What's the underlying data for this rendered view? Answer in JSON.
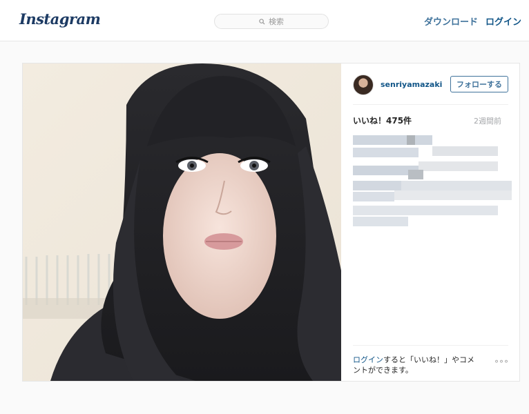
{
  "header": {
    "logo_text": "Instagram",
    "search": {
      "placeholder": "検索"
    },
    "download_label": "ダウンロード",
    "login_label": "ログイン"
  },
  "post": {
    "username": "senriyamazaki",
    "follow_label": "フォローする",
    "likes_label": "いいね！475件",
    "time_ago": "2週間前",
    "login_prompt_link": "ログイン",
    "login_prompt_rest": "すると「いいね！」やコメントができます。",
    "more_label": "°°°"
  },
  "colors": {
    "brand": "#125688",
    "link": "#3f729b",
    "page_bg": "#fafafa"
  },
  "icons": {
    "search": "search-icon",
    "more": "more-options-icon"
  }
}
